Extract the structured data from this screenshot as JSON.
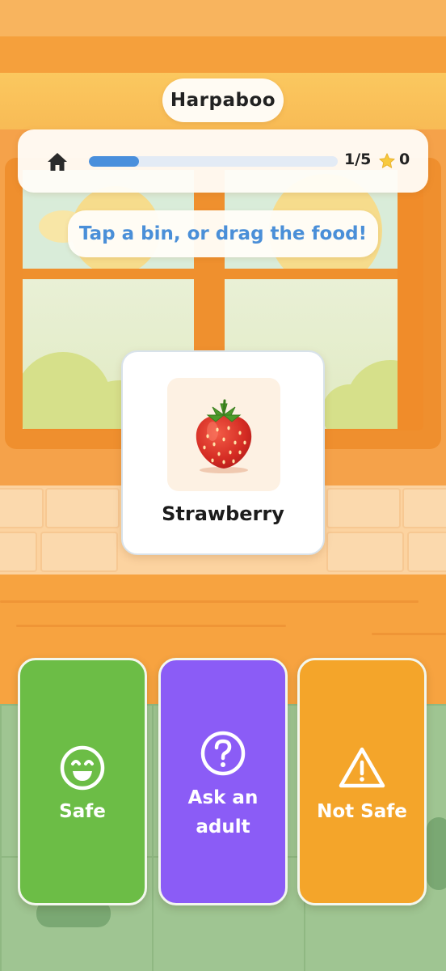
{
  "app": {
    "title": "Harpaboo"
  },
  "header": {
    "home_icon": "home-icon",
    "progress": {
      "current": 1,
      "total": 5,
      "fraction": 0.2,
      "label": "1/5"
    },
    "star_icon": "star-icon",
    "score": "0"
  },
  "hint": "Tap a bin, or drag the food!",
  "food": {
    "name": "Strawberry",
    "icon": "strawberry-image"
  },
  "bins": [
    {
      "id": "safe",
      "label": "Safe",
      "icon": "smile-icon",
      "color": "#6cbd46"
    },
    {
      "id": "ask",
      "label": "Ask an adult",
      "label_lines": [
        "Ask an",
        "adult"
      ],
      "icon": "question-icon",
      "color": "#8b5cf6"
    },
    {
      "id": "notsafe",
      "label": "Not Safe",
      "icon": "warning-icon",
      "color": "#f4a52a"
    }
  ],
  "colors": {
    "accent": "#4a8fdc",
    "progress_track": "#e3ebf5"
  }
}
